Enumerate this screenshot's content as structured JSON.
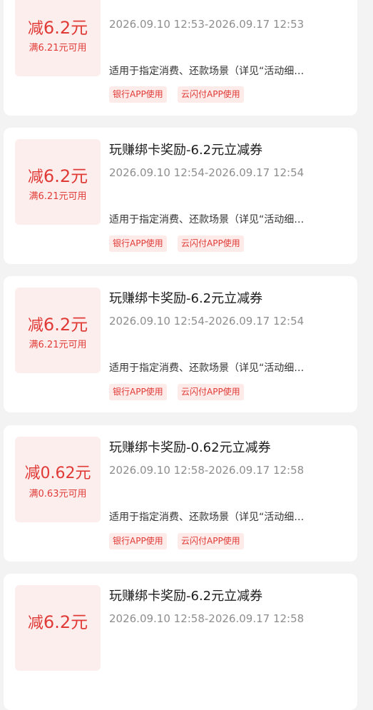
{
  "coupons": [
    {
      "amount_prefix": "减",
      "amount": "6.2元",
      "condition": "满6.21元可用",
      "title": "",
      "validity": "2026.09.10 12:53-2026.09.17 12:53",
      "description": "适用于指定消费、还款场景（详见“活动细…",
      "tags": [
        "银行APP使用",
        "云闪付APP使用"
      ]
    },
    {
      "amount_prefix": "减",
      "amount": "6.2元",
      "condition": "满6.21元可用",
      "title": "玩赚绑卡奖励-6.2元立减券",
      "validity": "2026.09.10 12:54-2026.09.17 12:54",
      "description": "适用于指定消费、还款场景（详见“活动细…",
      "tags": [
        "银行APP使用",
        "云闪付APP使用"
      ]
    },
    {
      "amount_prefix": "减",
      "amount": "6.2元",
      "condition": "满6.21元可用",
      "title": "玩赚绑卡奖励-6.2元立减券",
      "validity": "2026.09.10 12:54-2026.09.17 12:54",
      "description": "适用于指定消费、还款场景（详见“活动细…",
      "tags": [
        "银行APP使用",
        "云闪付APP使用"
      ]
    },
    {
      "amount_prefix": "减",
      "amount": "0.62元",
      "condition": "满0.63元可用",
      "title": "玩赚绑卡奖励-0.62元立减券",
      "validity": "2026.09.10 12:58-2026.09.17 12:58",
      "description": "适用于指定消费、还款场景（详见“活动细…",
      "tags": [
        "银行APP使用",
        "云闪付APP使用"
      ]
    },
    {
      "amount_prefix": "减",
      "amount": "6.2元",
      "condition": "",
      "title": "玩赚绑卡奖励-6.2元立减券",
      "validity": "2026.09.10 12:58-2026.09.17 12:58",
      "description": "",
      "tags": []
    }
  ]
}
